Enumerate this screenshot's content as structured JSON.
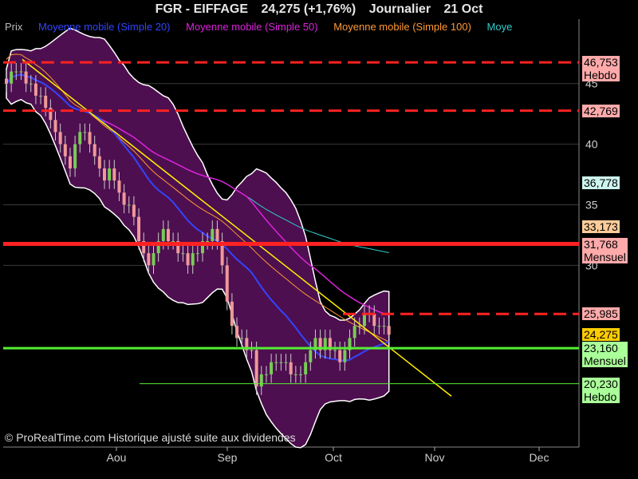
{
  "header": {
    "ticker": "FGR - EIFFAGE",
    "price": "24,275 (+1,76%)",
    "period": "Journalier",
    "date": "21 Oct"
  },
  "legend": [
    {
      "label": "Prix",
      "color": "#bbbbbb"
    },
    {
      "label": "Moyenne mobile (Simple 20)",
      "color": "#3344ff"
    },
    {
      "label": "Moyenne mobile (Simple 50)",
      "color": "#dd22dd"
    },
    {
      "label": "Moyenne mobile (Simple 100)",
      "color": "#ff9933"
    },
    {
      "label": "Moye",
      "color": "#33cccc"
    }
  ],
  "copyright": "© ProRealTime.com Historique ajusté suite aux dividendes",
  "colors": {
    "up": "#77cc55",
    "down": "#ee9999",
    "band": "#4d0f4f",
    "resistance": "#ff2222",
    "support": "#55ee33",
    "trend": "#ffee00"
  },
  "chart_data": {
    "type": "candlestick",
    "x_labels": [
      "Aou",
      "Sep",
      "Oct",
      "Nov",
      "Dec"
    ],
    "y_ticks": [
      30,
      35,
      40,
      45
    ],
    "ylim": [
      15,
      49
    ],
    "close_series": [
      45,
      46,
      46,
      46,
      45,
      45,
      44,
      44,
      43,
      42,
      41,
      40,
      39,
      38,
      40,
      41,
      41,
      40,
      39,
      38,
      37,
      38,
      37,
      36,
      35,
      35,
      34,
      32,
      31,
      30,
      31,
      32,
      33,
      32,
      32,
      31,
      31,
      30,
      31,
      31,
      32,
      32,
      33,
      32,
      30,
      27,
      25,
      24,
      24,
      23,
      23,
      20,
      21,
      21,
      22,
      22,
      22,
      22,
      21,
      21,
      21,
      22,
      23,
      24,
      23,
      24,
      23,
      23,
      22,
      23,
      24,
      25,
      25,
      26,
      26,
      25,
      25,
      25,
      24.275
    ],
    "levels": [
      {
        "value": 46.753,
        "label": "Hebdo",
        "style": "dashed",
        "color": "#ff2222"
      },
      {
        "value": 42.769,
        "label": "",
        "style": "dashed",
        "color": "#ff2222"
      },
      {
        "value": 36.778,
        "label": "",
        "style": "none",
        "color": "#33cccc"
      },
      {
        "value": 33.173,
        "label": "",
        "style": "none",
        "color": "#ff9933"
      },
      {
        "value": 31.768,
        "label": "Mensuel",
        "style": "solid",
        "color": "#ff2222"
      },
      {
        "value": 25.985,
        "label": "",
        "style": "dashed",
        "color": "#ff2222"
      },
      {
        "value": 24.275,
        "label": "",
        "style": "none",
        "color": "#ffcc00"
      },
      {
        "value": 23.16,
        "label": "Mensuel",
        "style": "solid",
        "color": "#55ee33"
      },
      {
        "value": 20.23,
        "label": "Hebdo",
        "style": "thin",
        "color": "#55ee33"
      }
    ],
    "level_texts": [
      "46,753",
      "42,769",
      "36,778",
      "33,173",
      "31,768",
      "25,985",
      "24,275",
      "23,160",
      "20,230"
    ]
  }
}
